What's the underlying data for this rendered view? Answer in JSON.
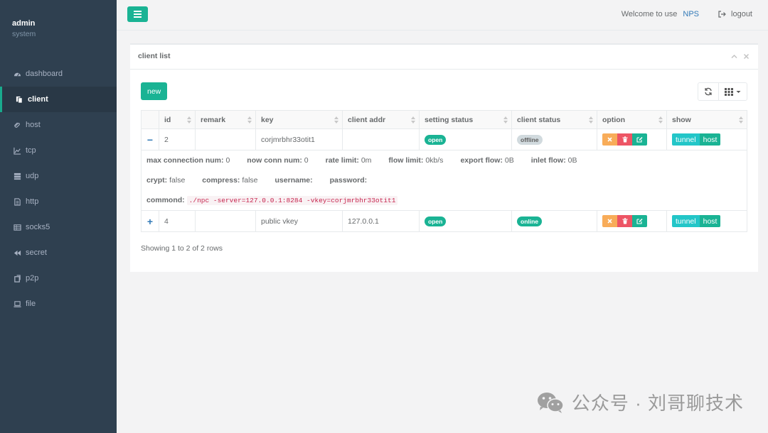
{
  "sidebar": {
    "user": "admin",
    "role": "system",
    "items": [
      {
        "label": "dashboard",
        "icon": "tachometer-icon"
      },
      {
        "label": "client",
        "icon": "copy-icon"
      },
      {
        "label": "host",
        "icon": "paperclip-icon"
      },
      {
        "label": "tcp",
        "icon": "line-chart-icon"
      },
      {
        "label": "udp",
        "icon": "server-icon"
      },
      {
        "label": "http",
        "icon": "file-icon"
      },
      {
        "label": "socks5",
        "icon": "table-icon"
      },
      {
        "label": "secret",
        "icon": "backward-icon"
      },
      {
        "label": "p2p",
        "icon": "clone-icon"
      },
      {
        "label": "file",
        "icon": "laptop-icon"
      }
    ],
    "active": "client"
  },
  "topbar": {
    "welcome": "Welcome to use",
    "brand": "NPS",
    "logout": "logout"
  },
  "panel": {
    "title": "client list",
    "new_label": "new"
  },
  "table": {
    "columns": [
      "id",
      "remark",
      "key",
      "client addr",
      "setting status",
      "client status",
      "option",
      "show"
    ],
    "rows": [
      {
        "toggle": "−",
        "id": "2",
        "remark": "",
        "key": "corjmrbhr33otit1",
        "client_addr": "",
        "setting_status": "open",
        "client_status": "offline",
        "expanded": true,
        "show_tunnel": "tunnel",
        "show_host": "host"
      },
      {
        "toggle": "+",
        "id": "4",
        "remark": "",
        "key": "public vkey",
        "client_addr": "127.0.0.1",
        "setting_status": "open",
        "client_status": "online",
        "expanded": false,
        "show_tunnel": "tunnel",
        "show_host": "host"
      }
    ],
    "detail": {
      "max_conn_label": "max connection num:",
      "max_conn_value": "0",
      "now_conn_label": "now conn num:",
      "now_conn_value": "0",
      "rate_label": "rate limit:",
      "rate_value": "0m",
      "flow_label": "flow limit:",
      "flow_value": "0kb/s",
      "export_label": "export flow:",
      "export_value": "0B",
      "inlet_label": "inlet flow:",
      "inlet_value": "0B",
      "crypt_label": "crypt:",
      "crypt_value": "false",
      "compress_label": "compress:",
      "compress_value": "false",
      "username_label": "username:",
      "username_value": "",
      "password_label": "password:",
      "password_value": "",
      "command_label": "commond:",
      "command_value": "./npc -server=127.0.0.1:8284 -vkey=corjmrbhr33otit1"
    },
    "summary": "Showing 1 to 2 of 2 rows"
  },
  "watermark": {
    "text": "公众号 · 刘哥聊技术"
  },
  "colors": {
    "sidebar_bg": "#2f4050",
    "primary": "#1ab394",
    "info": "#23c6c8",
    "warning": "#f8ac59",
    "danger": "#ed5565",
    "link": "#337ab7"
  }
}
